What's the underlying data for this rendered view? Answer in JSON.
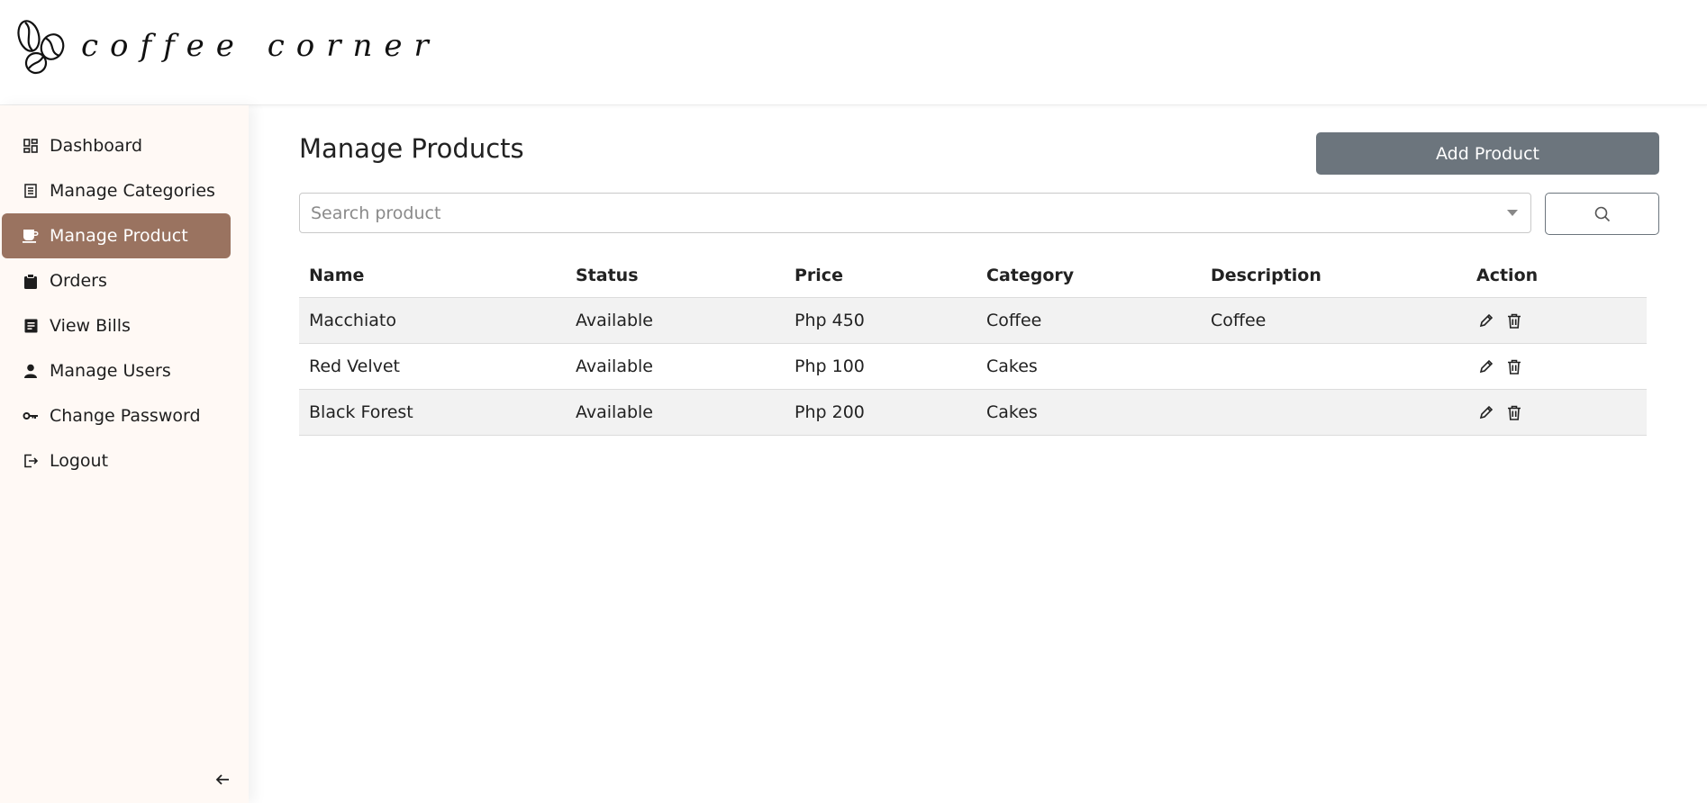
{
  "brand": {
    "name": "coffee corner"
  },
  "sidebar": {
    "items": [
      {
        "label": "Dashboard",
        "icon": "dashboard-icon"
      },
      {
        "label": "Manage Categories",
        "icon": "list-icon"
      },
      {
        "label": "Manage Product",
        "icon": "coffee-cup-icon",
        "active": true
      },
      {
        "label": "Orders",
        "icon": "clipboard-icon"
      },
      {
        "label": "View Bills",
        "icon": "bill-icon"
      },
      {
        "label": "Manage Users",
        "icon": "user-icon"
      },
      {
        "label": "Change Password",
        "icon": "key-icon"
      },
      {
        "label": "Logout",
        "icon": "logout-icon"
      }
    ],
    "collapse_icon": "arrow-left-icon"
  },
  "main": {
    "title": "Manage Products",
    "add_button_label": "Add Product",
    "search": {
      "placeholder": "Search product",
      "value": ""
    },
    "table": {
      "headers": [
        "Name",
        "Status",
        "Price",
        "Category",
        "Description",
        "Action"
      ],
      "rows": [
        {
          "name": "Macchiato",
          "status": "Available",
          "price": "Php 450",
          "category": "Coffee",
          "description": "Coffee"
        },
        {
          "name": "Red Velvet",
          "status": "Available",
          "price": "Php 100",
          "category": "Cakes",
          "description": ""
        },
        {
          "name": "Black Forest",
          "status": "Available",
          "price": "Php 200",
          "category": "Cakes",
          "description": ""
        }
      ]
    }
  },
  "colors": {
    "active_nav": "#9a7360",
    "sidebar_bg": "#fff9f5",
    "add_button": "#6c757d",
    "row_stripe": "#f2f2f2"
  }
}
